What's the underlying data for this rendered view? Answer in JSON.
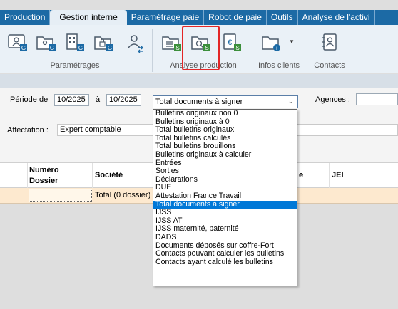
{
  "ribbon": {
    "tabs": [
      {
        "label": "Production"
      },
      {
        "label": "Gestion interne"
      },
      {
        "label": "Paramétrage paie"
      },
      {
        "label": "Robot de paie"
      },
      {
        "label": "Outils"
      },
      {
        "label": "Analyse de l'activi"
      }
    ],
    "active_tab": "Gestion interne",
    "groups": {
      "parametrages": "Paramétrages",
      "analyse": "Analyse production",
      "infos": "Infos clients",
      "contacts": "Contacts"
    }
  },
  "filters": {
    "periode_label": "Période de",
    "periode_from": "10/2025",
    "a_label": "à",
    "periode_to": "10/2025",
    "type_selected": "Total documents à signer",
    "agences_label": "Agences :",
    "agences_value": "",
    "affectation_label": "Affectation :",
    "affectation_value": "Expert comptable"
  },
  "grid": {
    "columns": {
      "numero_line1": "Numéro",
      "numero_line2": "Dossier",
      "societe": "Société",
      "hidden_e": "e",
      "jei": "JEI"
    },
    "total_row": "Total (0 dossier)"
  },
  "dropdown": {
    "selected_index": 17,
    "options": [
      "Bulletins originaux non 0",
      "Bulletins originaux à 0",
      "Total bulletins originaux",
      "Total bulletins calculés",
      "Total bulletins brouillons",
      "Bulletins originaux à calculer",
      "Entrées",
      "Sorties",
      "Déclarations",
      "DUE",
      "Attestation France Travail",
      "Total documents à signer",
      "IJSS",
      "IJSS AT",
      "IJSS maternité, paternité",
      "DADS",
      "Documents déposés sur coffre-Fort",
      "Contacts pouvant calculer les bulletins",
      "Contacts ayant calculé les bulletins"
    ]
  },
  "colors": {
    "tab_bar": "#1c6aa5",
    "ribbon_bg": "#eaf1f7",
    "highlight": "#e32626",
    "selected_option": "#0078d7",
    "total_row": "#fde9cf"
  }
}
